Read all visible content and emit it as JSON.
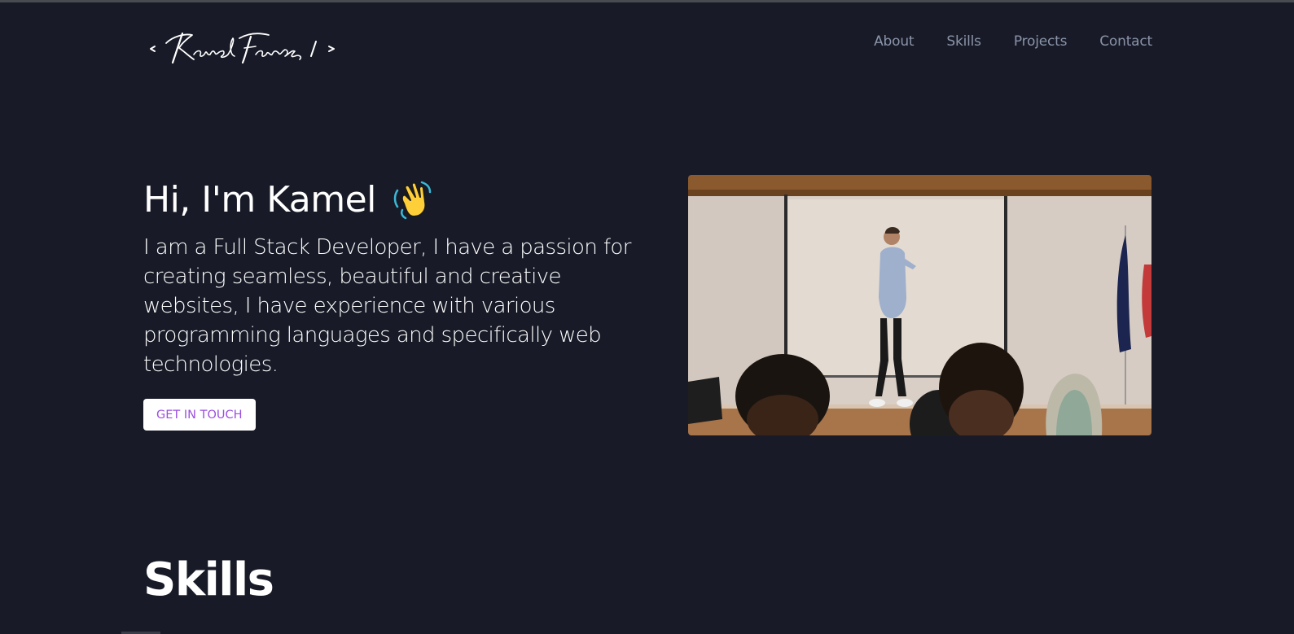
{
  "header": {
    "logo_text": "< Kamel Fawaz / >",
    "nav": [
      {
        "label": "About"
      },
      {
        "label": "Skills"
      },
      {
        "label": "Projects"
      },
      {
        "label": "Contact"
      }
    ]
  },
  "hero": {
    "title": "Hi, I'm Kamel",
    "description": "I am a Full Stack Developer, I have a passion for creating seamless, beautiful and creative websites, I have experience with various programming languages and specifically web technologies.",
    "cta_label": "GET IN TOUCH",
    "wave_icon": "waving-hand-emoji"
  },
  "skills": {
    "title": "Skills"
  },
  "colors": {
    "background": "#181b27",
    "nav_text": "#8a93a8",
    "button_text": "#9b4fe0",
    "button_bg": "#ffffff"
  }
}
